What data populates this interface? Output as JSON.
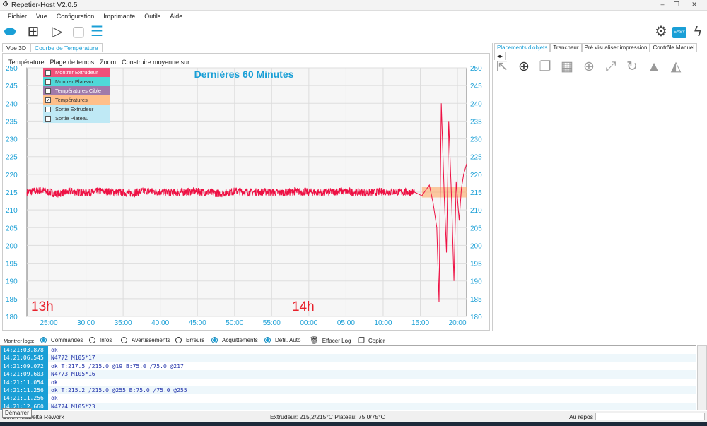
{
  "window": {
    "title": "Repetier-Host V2.0.5"
  },
  "menu": [
    "Fichier",
    "Vue",
    "Configuration",
    "Imprimante",
    "Outils",
    "Aide"
  ],
  "toolbar": {
    "easy_label": "EASY"
  },
  "tabs": [
    {
      "label": "Vue 3D",
      "selected": false
    },
    {
      "label": "Courbe de Température",
      "selected": true
    }
  ],
  "graph_menu": [
    "Température",
    "Plage de temps",
    "Zoom",
    "Construire moyenne sur ..."
  ],
  "legend": [
    {
      "label": "Montrer Extrudeur",
      "checked": true,
      "color": "#f0507a"
    },
    {
      "label": "Montrer Plateau",
      "checked": false,
      "color": "#4fd8d8"
    },
    {
      "label": "Températures Cible",
      "checked": true,
      "color": "#a07aaa"
    },
    {
      "label": "Températures",
      "checked": true,
      "color": "#ffbf8a"
    },
    {
      "label": "Sortie Extrudeur",
      "checked": false,
      "color": "#bfe9f5"
    },
    {
      "label": "Sortie Plateau",
      "checked": false,
      "color": "#bfe9f5"
    }
  ],
  "chart_data": {
    "type": "line",
    "title": "Dernières 60 Minutes",
    "ylim": [
      180,
      250
    ],
    "yticks": [
      180,
      185,
      190,
      195,
      200,
      205,
      210,
      215,
      220,
      225,
      230,
      235,
      240,
      245,
      250
    ],
    "xlim": [
      "13:22",
      "14:21"
    ],
    "xticks": [
      "25:00",
      "30:00",
      "35:00",
      "40:00",
      "45:00",
      "50:00",
      "55:00",
      "00:00",
      "05:00",
      "10:00",
      "15:00",
      "20:00"
    ],
    "hour_labels": [
      {
        "label": "13h",
        "at": "13:22"
      },
      {
        "label": "14h",
        "at": "13:57"
      }
    ],
    "grid": true,
    "series": [
      {
        "color": "#ee1144",
        "x": [
          "13:22",
          "13:24",
          "13:26",
          "13:28",
          "13:30",
          "13:32",
          "13:34",
          "13:36",
          "13:38",
          "13:40",
          "13:42",
          "13:44",
          "13:46",
          "13:48",
          "13:50",
          "13:52",
          "13:54",
          "13:56",
          "13:58",
          "14:00",
          "14:02",
          "14:04",
          "14:06",
          "14:08",
          "14:10",
          "14:12",
          "14:14",
          "14:15",
          "14:16",
          "14:16.5",
          "14:17",
          "14:17.3",
          "14:17.6",
          "14:18",
          "14:18.3",
          "14:18.6",
          "14:19",
          "14:19.3",
          "14:19.6",
          "14:20",
          "14:20.3",
          "14:20.6",
          "14:21"
        ],
        "y": [
          215,
          215.5,
          214.5,
          215.2,
          214.8,
          215.3,
          215,
          214.7,
          215.4,
          215,
          214.9,
          215.2,
          215,
          214.6,
          215.3,
          215,
          215.1,
          214.8,
          215.2,
          215,
          214.9,
          215.3,
          215,
          214.8,
          215.2,
          215,
          215,
          214,
          217,
          212,
          205,
          184,
          240,
          214,
          198,
          235,
          212,
          190,
          218,
          207,
          216,
          220,
          223
        ]
      },
      {
        "color": "#ffaa66",
        "x": [
          "14:15",
          "14:21"
        ],
        "y": [
          215,
          215
        ]
      }
    ]
  },
  "right_tabs": [
    "Placements d'objets",
    "Trancheur",
    "Pré visualiser impression",
    "Contrôle Manuel"
  ],
  "logs": {
    "label": "Montrer logs:",
    "options": [
      {
        "label": "Commandes",
        "on": true
      },
      {
        "label": "Infos",
        "on": false
      },
      {
        "label": "Avertissements",
        "on": false
      },
      {
        "label": "Erreurs",
        "on": false
      },
      {
        "label": "Acquittements",
        "on": true
      },
      {
        "label": "Défil. Auto",
        "on": true
      }
    ],
    "clear": "Effacer Log",
    "copy": "Copier",
    "rows": [
      {
        "t": "14:21:03.878",
        "m": "ok"
      },
      {
        "t": "14:21:06.545",
        "m": "N4772 M105*17"
      },
      {
        "t": "14:21:09.072",
        "m": "ok T:217.5 /215.0 @19 B:75.0 /75.0 @217"
      },
      {
        "t": "14:21:09.603",
        "m": "N4773 M105*16"
      },
      {
        "t": "14:21:11.054",
        "m": "ok"
      },
      {
        "t": "14:21:11.256",
        "m": "ok T:215.2 /215.0 @255 B:75.0 /75.0 @255"
      },
      {
        "t": "14:21:11.256",
        "m": "ok"
      },
      {
        "t": "14:21:12.660",
        "m": "N4774 M105*23"
      }
    ]
  },
  "status": {
    "left": "Con... ...oDelta Rework",
    "temps": "Extrudeur: 215,2/215°C Plateau: 75,0/75°C",
    "state": "Au repos"
  },
  "tooltip": "Démarrer"
}
